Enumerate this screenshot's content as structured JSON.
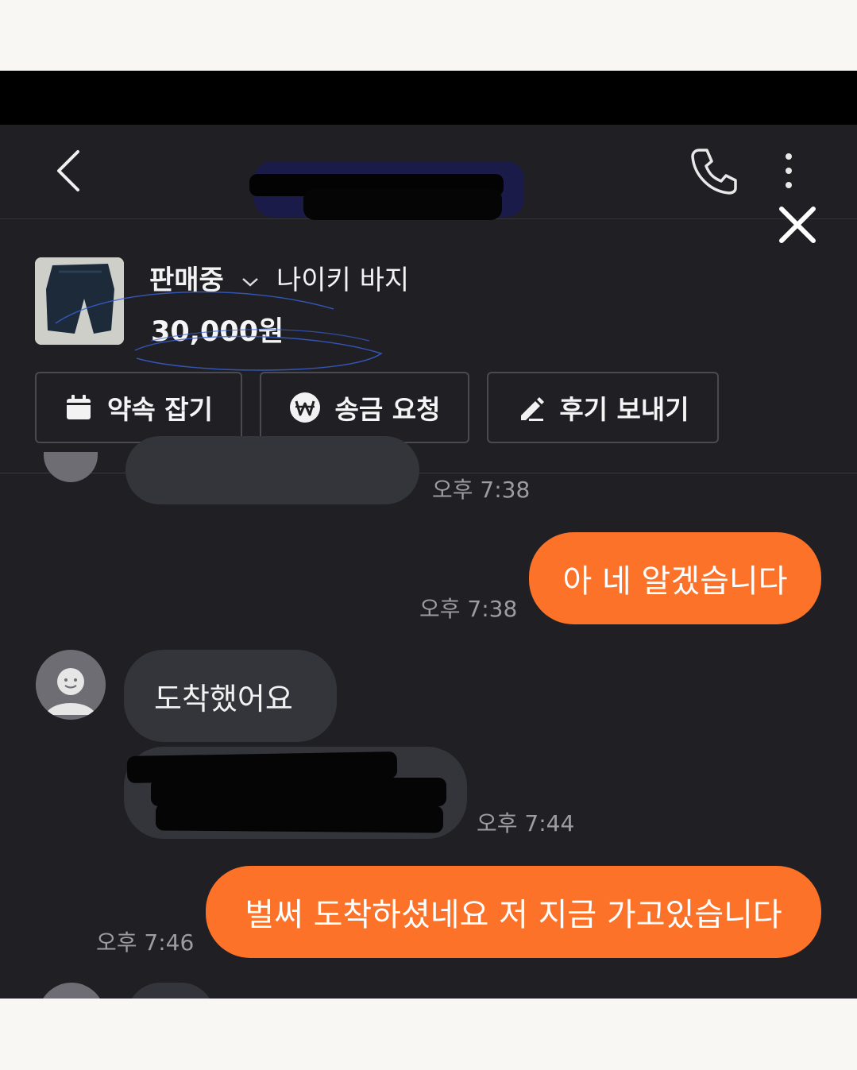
{
  "product": {
    "status_label": "판매중",
    "title": "나이키 바지",
    "price": "30,000원"
  },
  "actions": {
    "schedule_label": "약속 잡기",
    "transfer_label": "송금 요청",
    "review_label": "후기 보내기"
  },
  "messages": {
    "top_partial_time": "오후 7:38",
    "reply_1_text": "아 네 알겠습니다",
    "reply_1_time": "오후 7:38",
    "incoming_1_text": "도착했어요",
    "incoming_2_time": "오후 7:44",
    "reply_2_text": "벌써 도착하셨네요 저 지금 가고있습니다",
    "reply_2_time": "오후 7:46"
  },
  "colors": {
    "background": "#1f1f24",
    "incoming_bubble": "#34343b",
    "outgoing_bubble": "#fb7228"
  },
  "icons": [
    "chevron-left-icon",
    "phone-icon",
    "more-vertical-icon",
    "close-icon",
    "chevron-down-icon",
    "calendar-icon",
    "won-icon",
    "pencil-icon",
    "user-avatar-icon"
  ]
}
